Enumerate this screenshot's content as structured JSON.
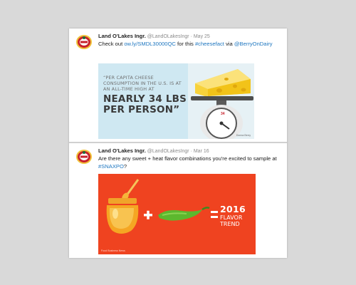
{
  "tweets": [
    {
      "author_name": "Land O'Lakes Ingr.",
      "handle_date": "@LandOLakesIngr · May 25",
      "text_before": "Check out ",
      "link": "ow.ly/SMDL30000QC",
      "text_mid": " for this ",
      "hashtag": "#cheesefact",
      "text_after": " via ",
      "mention": "@BerryOnDairy",
      "image": {
        "quote_top": "“PER CAPITA CHEESE CONSUMPTION IN THE U.S. IS AT AN ALL-TIME HIGH AT",
        "quote_main": "NEARLY 34 LBS PER PERSON”",
        "scale_number": "34",
        "credit": "Donna Berry"
      }
    },
    {
      "author_name": "Land O'Lakes Ingr.",
      "handle_date": "@LandOLakesIngr · Mar 16",
      "text_before": "Are there any sweet + heat flavor combinations you're excited to sample at ",
      "hashtag": "#SNAXPO",
      "text_after": "?",
      "image": {
        "year": "2016",
        "flavor": "FLAVOR",
        "trend": "TREND",
        "credit": "Food Business News"
      }
    }
  ],
  "colors": {
    "link": "#1f77c0",
    "image2_background": "#ef4320",
    "image1_background": "#cfe8f2",
    "cheese": "#f7d23b"
  },
  "icons": {
    "avatar": "land-o-lakes-logo",
    "honey": "honey-jar-icon",
    "pepper": "jalapeno-pepper-icon",
    "scale": "kitchen-scale-icon"
  }
}
